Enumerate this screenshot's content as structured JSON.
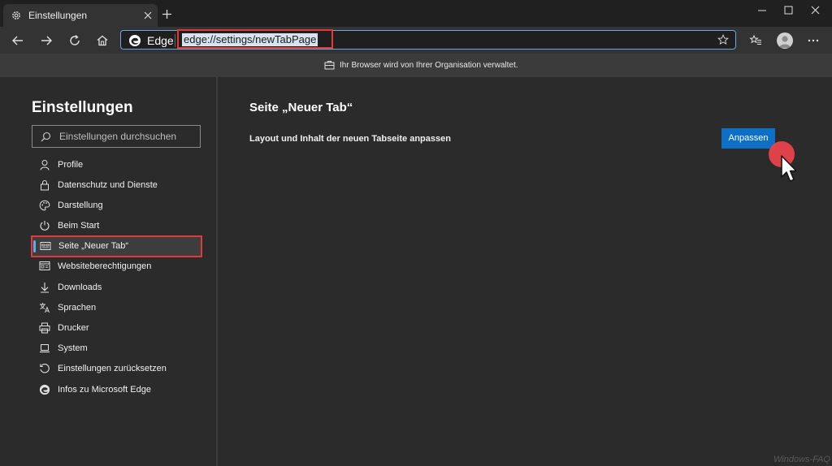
{
  "browser": {
    "tab_title": "Einstellungen",
    "address_prefix": "Edge",
    "url": "edge://settings/newTabPage",
    "managed_notice": "Ihr Browser wird von Ihrer Organisation verwaltet."
  },
  "sidebar": {
    "title": "Einstellungen",
    "search_placeholder": "Einstellungen durchsuchen",
    "items": [
      {
        "label": "Profile",
        "icon": "person-icon"
      },
      {
        "label": "Datenschutz und Dienste",
        "icon": "lock-icon"
      },
      {
        "label": "Darstellung",
        "icon": "palette-icon"
      },
      {
        "label": "Beim Start",
        "icon": "power-icon"
      },
      {
        "label": "Seite „Neuer Tab“",
        "icon": "newtab-page-icon",
        "active": true
      },
      {
        "label": "Websiteberechtigungen",
        "icon": "site-permissions-icon"
      },
      {
        "label": "Downloads",
        "icon": "download-icon"
      },
      {
        "label": "Sprachen",
        "icon": "language-icon"
      },
      {
        "label": "Drucker",
        "icon": "printer-icon"
      },
      {
        "label": "System",
        "icon": "laptop-icon"
      },
      {
        "label": "Einstellungen zurücksetzen",
        "icon": "reset-icon"
      },
      {
        "label": "Infos zu Microsoft Edge",
        "icon": "edge-logo-icon"
      }
    ]
  },
  "main": {
    "title": "Seite „Neuer Tab“",
    "section_label": "Layout und Inhalt der neuen Tabseite anpassen",
    "customize_button": "Anpassen"
  },
  "watermark": "Windows-FAQ",
  "colors": {
    "accent": "#0e6fc6",
    "highlight_border": "#e03a3a",
    "background": "#2b2b2b"
  }
}
